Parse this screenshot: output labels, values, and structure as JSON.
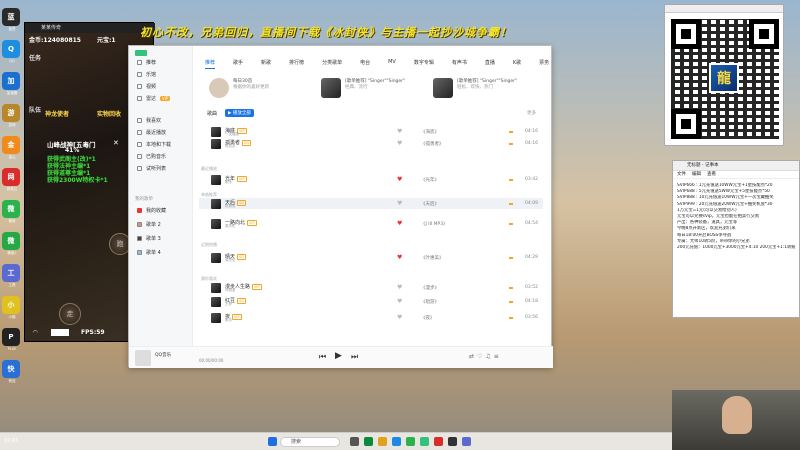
{
  "banner": "初心不改，兄弟回归，直播间下载《冰封侠》与主播一起抄沙城争霸！",
  "desktop": {
    "icons": [
      {
        "label": "蓝叠",
        "color": "#2a2a2a"
      },
      {
        "label": "QQ",
        "color": "#1e8fe0"
      },
      {
        "label": "加速器",
        "color": "#1a6fd0"
      },
      {
        "label": "游戏",
        "color": "#b8862b"
      },
      {
        "label": "金山",
        "color": "#f08a1a"
      },
      {
        "label": "网易云",
        "color": "#d92c2c"
      },
      {
        "label": "微信",
        "color": "#2bb24c"
      },
      {
        "label": "微信2",
        "color": "#27a844"
      },
      {
        "label": "工具",
        "color": "#5a6ad0"
      },
      {
        "label": "小鹅",
        "color": "#e0c11f"
      },
      {
        "label": "PLAY",
        "color": "#222222"
      },
      {
        "label": "快连",
        "color": "#2a6fd6"
      }
    ],
    "corner_time": "10:41"
  },
  "game": {
    "title": "某某传奇",
    "gold": "金币:124080815",
    "yuanbao": "元宝:1",
    "left_tabs": [
      "任务",
      "队伍"
    ],
    "npc_label": "神龙使者",
    "npc_label2": "实物回收",
    "quest_title": "山峰战神[五毒门",
    "quest_percent": "41%",
    "quests": [
      "获得武阁主(改)*1",
      "获得法神主编*1",
      "获得道尊主编*1",
      "获得2300W特权卡*1"
    ],
    "fps": "FPS:59",
    "btn1": "跑",
    "btn2": "走"
  },
  "app": {
    "sidebar": [
      {
        "label": "推荐"
      },
      {
        "label": "乐馆"
      },
      {
        "label": "视频"
      },
      {
        "label": "雷达",
        "tag": "VIP"
      },
      {
        "label": "我喜欢"
      },
      {
        "label": "最近播放"
      },
      {
        "label": "本地和下载"
      },
      {
        "label": "已购音乐"
      },
      {
        "label": "试听列表"
      }
    ],
    "playlists_title": "我的歌单",
    "playlists": [
      "我的收藏",
      "歌单 2",
      "歌单 3",
      "歌单 4"
    ],
    "tabs": [
      "推荐",
      "歌手",
      "新歌",
      "排行榜",
      "分类歌单",
      "电台",
      "MV",
      "数字专辑",
      "有声书",
      "直播",
      "K歌",
      "票务"
    ],
    "active_tab": "推荐",
    "cards": [
      {
        "title": "每日30首",
        "desc": "根据你的喜好更新"
      },
      {
        "title": "[歌单推荐] \"Singer\"\"Singer\"",
        "desc": "经典、流行"
      },
      {
        "title": "[歌单推荐] \"Singer\"\"Singer\"",
        "desc": "轻松、欢快、热门"
      }
    ],
    "list_header": {
      "title": "歌曲",
      "button": "▶ 播放全部",
      "right": "更多"
    },
    "songs": [
      {
        "name": "海底",
        "artist": "一支榴莲",
        "badge": "VIP",
        "album": "《海底》",
        "liked": false,
        "dur": "04:16"
      },
      {
        "name": "孤勇者",
        "artist": "陈奕迅",
        "badge": "SQ",
        "album": "《孤勇者》",
        "liked": false,
        "dur": "04:16"
      },
      {
        "name": "光年",
        "artist": "歌手",
        "badge": "VIP",
        "album": "《光年》",
        "liked": true,
        "dur": "03:42"
      },
      {
        "name": "天后",
        "artist": "陈势安",
        "badge": "SQ",
        "album": "《天后》",
        "liked": false,
        "dur": "04:09"
      },
      {
        "name": "一路向北",
        "artist": "周杰伦",
        "badge": "VIP",
        "album": "《J III MP3》",
        "liked": true,
        "dur": "04:54"
      },
      {
        "name": "晴天",
        "artist": "周杰伦",
        "badge": "SQ",
        "album": "《叶惠美》",
        "liked": true,
        "dur": "04:29"
      },
      {
        "name": "漫步人生路",
        "artist": "邓丽君",
        "badge": "VIP",
        "album": "《漫步》",
        "liked": false,
        "dur": "03:52"
      },
      {
        "name": "红豆",
        "artist": "王菲",
        "badge": "SQ",
        "album": "《唱游》",
        "liked": false,
        "dur": "04:18"
      },
      {
        "name": "夜",
        "artist": "歌手",
        "badge": "VIP",
        "album": "《夜》",
        "liked": false,
        "dur": "03:56"
      }
    ],
    "sections": [
      "最近播放",
      "单曲推荐",
      "近期热播",
      "猜你喜欢"
    ],
    "player": {
      "title": "QQ音乐",
      "time": "00:00/00:00"
    }
  },
  "notepad": {
    "title": "无标题 - 记事本",
    "menu": [
      "文件",
      "编辑",
      "查看"
    ],
    "lines": [
      "SVIP666 : 1元充值送10WW元宝+1星技能点*20",
      "SVIP688 : 5元充值送5WW元宝+5星技能点*50",
      "SVIP888 : 10元充值送10WW元宝+一次宝藏抽奖",
      "SVIP999 : 20元充值送20WW元宝+抽奖机会*30",
      "1万元宝=1元(可以交易给别人)",
      "元宝可以兑换sVip，元宝也能在拍卖行交易",
      "产出：各种装备，道具，元宝等",
      "今晚8点开新区，欢迎兄弟们来",
      "每日18:00开启BOSS争夺战",
      "专属：大师10转5阶，带带你的小兄弟",
      "200元充值：1000元宝+3000元宝+4:10 200元宝+1:1转账"
    ]
  }
}
